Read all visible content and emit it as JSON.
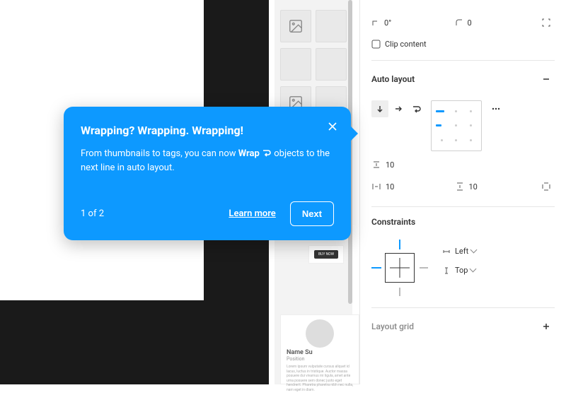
{
  "transform": {
    "rotation": "0°",
    "corner_radius": "0",
    "clip_content_label": "Clip content"
  },
  "auto_layout": {
    "title": "Auto layout",
    "horizontal_gap": "10",
    "padding_h": "10",
    "padding_v": "10"
  },
  "constraints": {
    "title": "Constraints",
    "horizontal": "Left",
    "vertical": "Top"
  },
  "layout_grid": {
    "title": "Layout grid"
  },
  "popover": {
    "title": "Wrapping? Wrapping. Wrapping!",
    "body_pre": "From thumbnails to tags, you can now ",
    "body_bold": "Wrap",
    "body_post": " objects to the next line in auto layout.",
    "counter": "1 of 2",
    "learn_more": "Learn more",
    "next": "Next"
  },
  "canvas_cards": {
    "buy_now": "BUY NOW",
    "profile_name": "Name Su",
    "profile_sub": "Position",
    "lorem": "Lorem ipsum vulputate cursus aliquet id lacus, luctus in tristique. Auctor massa posuere dui vivamus mi ligula, amet ante urna posuere sem donec justo eget hendrerit. Pharetra pharetra nibh nec nulla, nam eget in diam."
  }
}
